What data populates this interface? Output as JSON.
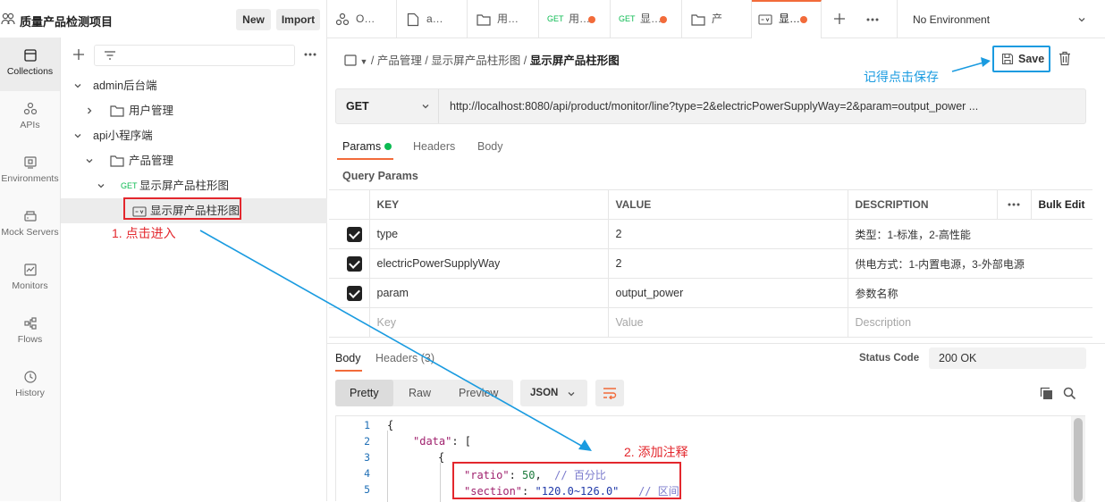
{
  "workspace": {
    "name": "质量产品检测项目",
    "new_label": "New",
    "import_label": "Import"
  },
  "rail": [
    {
      "label": "Collections",
      "icon": "collections-icon",
      "active": true
    },
    {
      "label": "APIs",
      "icon": "apis-icon"
    },
    {
      "label": "Environments",
      "icon": "environments-icon"
    },
    {
      "label": "Mock Servers",
      "icon": "mock-servers-icon"
    },
    {
      "label": "Monitors",
      "icon": "monitors-icon"
    },
    {
      "label": "Flows",
      "icon": "flows-icon"
    },
    {
      "label": "History",
      "icon": "history-icon"
    }
  ],
  "tree": {
    "admin": "admin后台端",
    "user_mgmt": "用户管理",
    "api": "api小程序端",
    "product_mgmt": "产品管理",
    "get_tag": "GET",
    "request": "显示屏产品柱形图",
    "example": "显示屏产品柱形图"
  },
  "tabs": [
    {
      "label": "O…",
      "icon": "apis-icon"
    },
    {
      "label": "a…",
      "icon": "document-icon"
    },
    {
      "label": "用…",
      "icon": "folder-icon"
    },
    {
      "label": "用…",
      "method": "GET",
      "dot": true
    },
    {
      "label": "显…",
      "method": "GET",
      "dot": true
    },
    {
      "label": "产",
      "icon": "folder-icon"
    },
    {
      "label": "显…",
      "icon": "example-icon",
      "dot": true,
      "active": true
    }
  ],
  "environment": "No Environment",
  "breadcrumb": {
    "part1": "产品管理",
    "part2": "显示屏产品柱形图",
    "current": "显示屏产品柱形图"
  },
  "save_label": "Save",
  "request": {
    "method": "GET",
    "url": "http://localhost:8080/api/product/monitor/line?type=2&electricPowerSupplyWay=2&param=output_power ..."
  },
  "request_tabs": {
    "params": "Params",
    "headers": "Headers",
    "body": "Body"
  },
  "query_params_title": "Query Params",
  "params_table": {
    "headers": {
      "key": "KEY",
      "value": "VALUE",
      "description": "DESCRIPTION",
      "bulk_edit": "Bulk Edit"
    },
    "rows": [
      {
        "key": "type",
        "value": "2",
        "description": "类型：1-标准，2-高性能"
      },
      {
        "key": "electricPowerSupplyWay",
        "value": "2",
        "description": "供电方式：1-内置电源，3-外部电源"
      },
      {
        "key": "param",
        "value": "output_power",
        "description": "参数名称"
      }
    ],
    "placeholder": {
      "key": "Key",
      "value": "Value",
      "description": "Description"
    }
  },
  "response": {
    "body_tab": "Body",
    "headers_tab": "Headers (3)",
    "status_label": "Status Code",
    "status_value": "200 OK",
    "views": {
      "pretty": "Pretty",
      "raw": "Raw",
      "preview": "Preview"
    },
    "format": "JSON"
  },
  "code_lines": [
    {
      "n": "1",
      "text": "{"
    },
    {
      "n": "2",
      "key": "\"data\"",
      "rest": ": ["
    },
    {
      "n": "3",
      "text": "{"
    },
    {
      "n": "4",
      "key": "\"ratio\"",
      "colon": ": ",
      "num": "50",
      "comma": ",  ",
      "comment": "// 百分比"
    },
    {
      "n": "5",
      "key": "\"section\"",
      "colon": ": ",
      "str": "\"120.0~126.0\"",
      "comment": "   // 区间"
    }
  ],
  "annotations": {
    "step1": "1. 点击进入",
    "step2": "2. 添加注释",
    "save_hint": "记得点击保存"
  },
  "colors": {
    "accent": "#f26b3a",
    "annotation_red": "#e3272d",
    "annotation_blue": "#1a9be0",
    "get_green": "#0cbb52"
  }
}
